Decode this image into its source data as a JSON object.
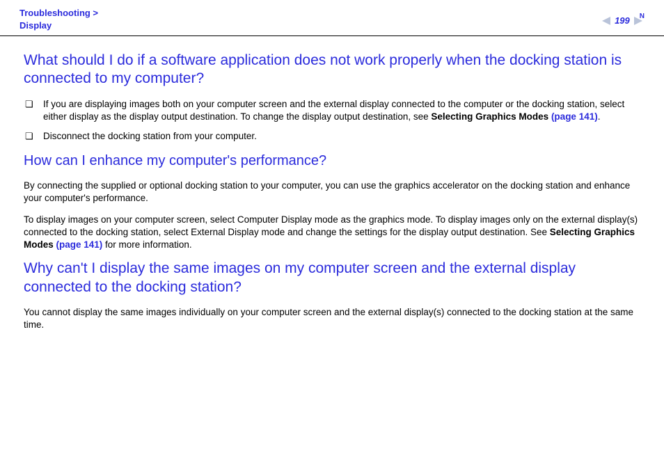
{
  "header": {
    "breadcrumb_line1": "Troubleshooting >",
    "breadcrumb_line2": "Display",
    "page_number": "199",
    "n_mark": "N"
  },
  "q1": {
    "heading": "What should I do if a software application does not work properly when the docking station is connected to my computer?",
    "bullet1_a": "If you are displaying images both on your computer screen and the external display connected to the computer or the docking station, select either display as the display output destination. To change the display output destination, see ",
    "bullet1_b": "Selecting Graphics Modes ",
    "bullet1_link": "(page 141)",
    "bullet1_c": ".",
    "bullet2": "Disconnect the docking station from your computer."
  },
  "q2": {
    "heading": "How can I enhance my computer's performance?",
    "p1": "By connecting the supplied or optional docking station to your computer, you can use the graphics accelerator on the docking station and enhance your computer's performance.",
    "p2a": "To display images on your computer screen, select Computer Display mode as the graphics mode. To display images only on the external display(s) connected to the docking station, select External Display mode and change the settings for the display output destination. See ",
    "p2b": "Selecting Graphics Modes ",
    "p2link": "(page 141)",
    "p2c": " for more information."
  },
  "q3": {
    "heading": "Why can't I display the same images on my computer screen and the external display connected to the docking station?",
    "p1": "You cannot display the same images individually on your computer screen and the external display(s) connected to the docking station at the same time."
  }
}
